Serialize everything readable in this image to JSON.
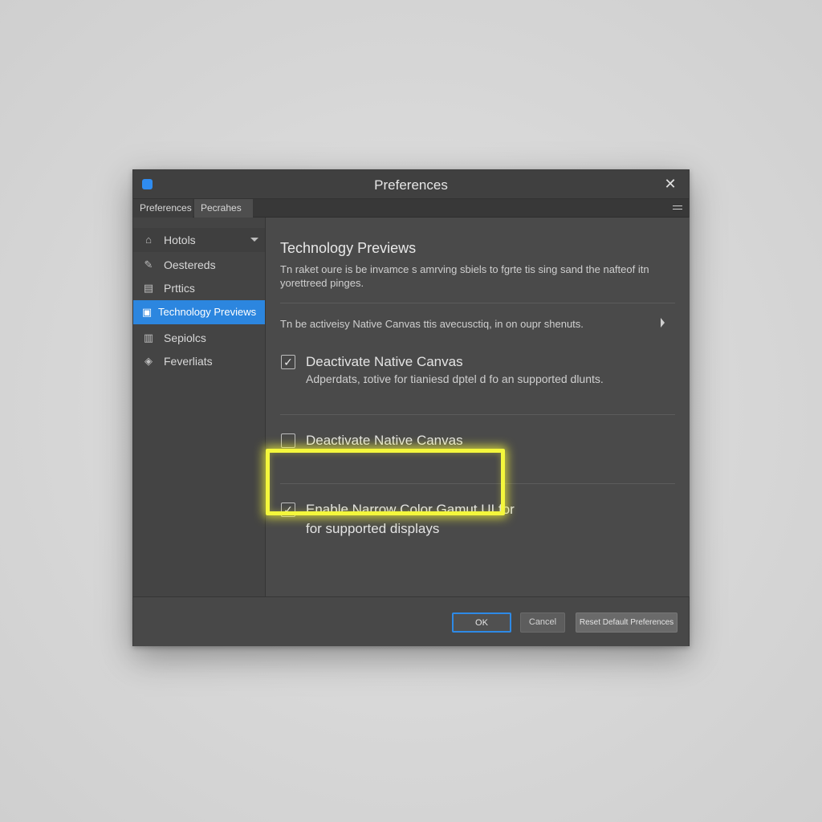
{
  "window": {
    "title": "Preferences",
    "close_glyph": "✕"
  },
  "tabs": [
    {
      "label": "Preferences"
    },
    {
      "label": "Pecrahes"
    }
  ],
  "sidebar": {
    "items": [
      {
        "label": "Hotols",
        "icon": "home-icon",
        "glyph": "⌂"
      },
      {
        "label": "Oestereds",
        "icon": "brush-icon",
        "glyph": "✎"
      },
      {
        "label": "Prttics",
        "icon": "doc-icon",
        "glyph": "▤"
      },
      {
        "label": "Technology Previews",
        "icon": "monitor-icon",
        "glyph": "▣",
        "selected": true
      },
      {
        "label": "Sepiolcs",
        "icon": "file-icon",
        "glyph": "▥"
      },
      {
        "label": "Feverliats",
        "icon": "shield-icon",
        "glyph": "◈"
      }
    ],
    "accent_color": "#2c86df"
  },
  "main": {
    "heading": "Technology Previews",
    "description": "Tn raket oure  is be invamce s amrving sbiels to fgrte tis sing sand the nafteof itn yorettreed pinges.",
    "note": "Tn be activeisy Native Canvas  ttis avecusctiq, in on oupr shenuts.",
    "options": [
      {
        "label": "Deactivate Native Canvas",
        "sublabel": "Adperdats, ɪotive for tianiesd dptel d fo an supported dlunts.",
        "checked": true,
        "check_glyph": "✓",
        "highlighted": true
      },
      {
        "label": "Deactivate Native Canvas",
        "checked": false,
        "check_glyph": ""
      },
      {
        "label": "Enable Narrow Color Gamut UI for",
        "label_line2": "for supported displays",
        "checked": true,
        "check_glyph": "✓"
      }
    ],
    "highlight_color": "#f4f73c"
  },
  "footer": {
    "ok_label": "OK",
    "cancel_label": "Cancel",
    "reset_label": "Reset Default Preferences"
  }
}
